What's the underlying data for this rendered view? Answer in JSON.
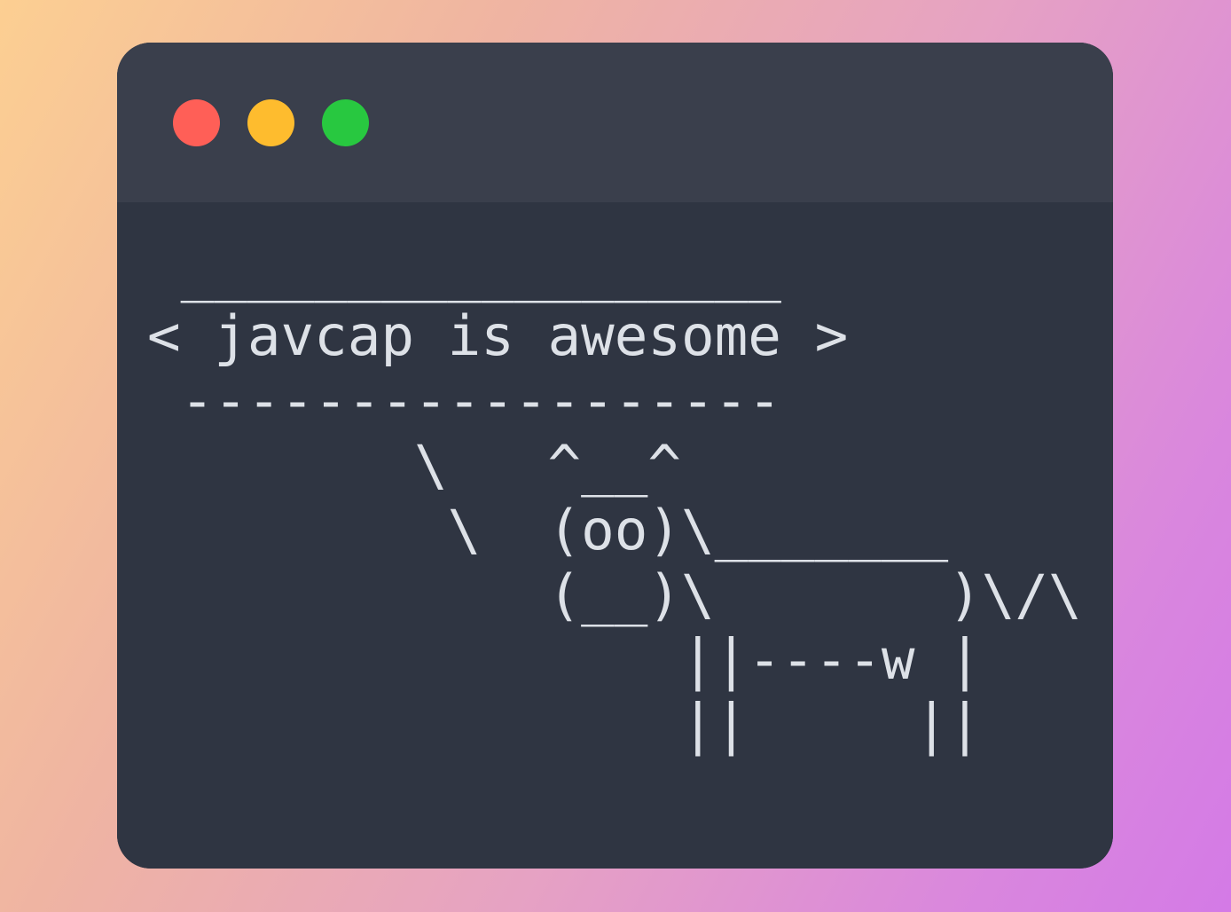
{
  "window": {
    "traffic_lights": [
      {
        "name": "close-button",
        "color": "#ff5f57"
      },
      {
        "name": "minimize-button",
        "color": "#febc2e"
      },
      {
        "name": "maximize-button",
        "color": "#28c840"
      }
    ]
  },
  "terminal": {
    "text_color": "#dde1e7",
    "output": " __________________\n< javcap is awesome >\n ------------------\n        \\   ^__^\n         \\  (oo)\\_______\n            (__)\\       )\\/\\\n                ||----w |\n                ||     ||"
  }
}
